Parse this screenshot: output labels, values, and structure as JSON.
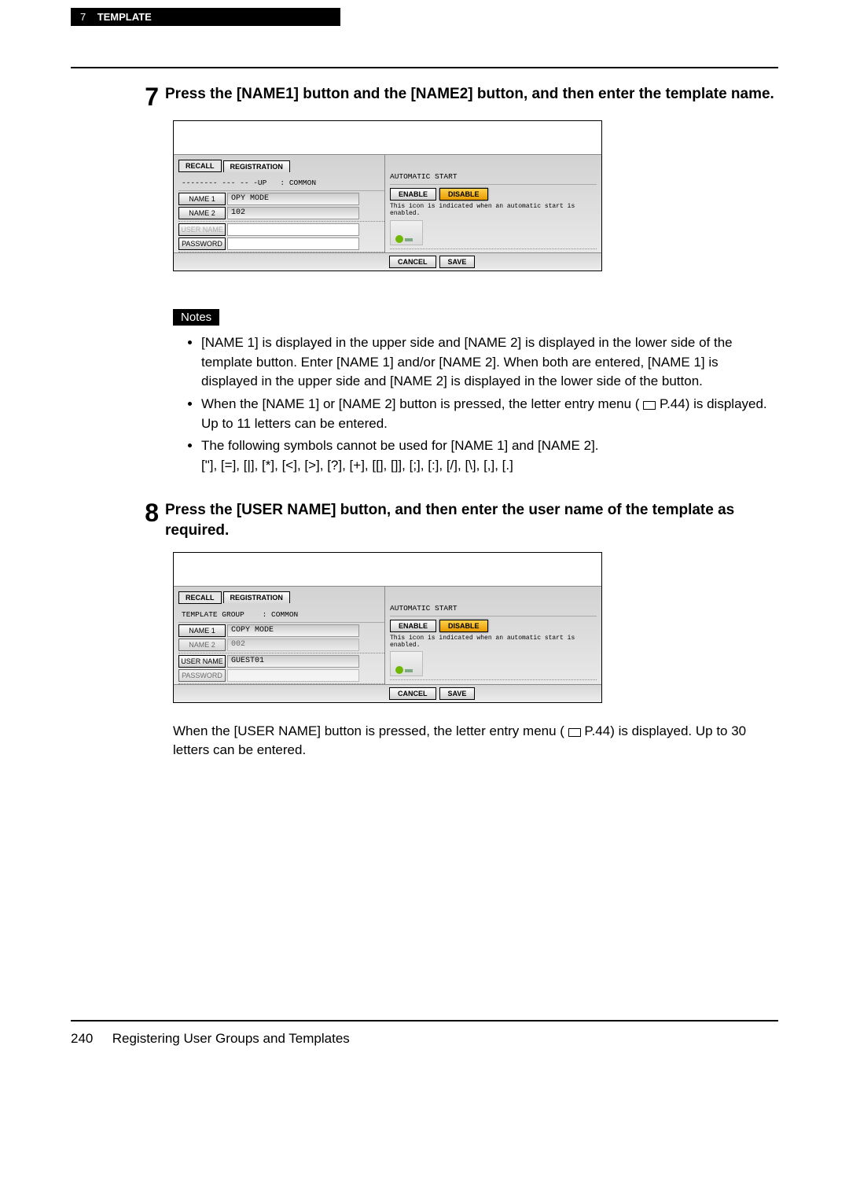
{
  "header": {
    "section_num": "7",
    "section_title": "TEMPLATE"
  },
  "step7": {
    "number": "7",
    "text": "Press the [NAME1] button and the [NAME2] button, and then enter the template name."
  },
  "panel1": {
    "recall": "RECALL",
    "registration": "REGISTRATION",
    "group_line": "-------- --- -- -UP   : COMMON",
    "name1_btn": "NAME 1",
    "name1_val": "OPY MODE",
    "name2_btn": "NAME 2",
    "name2_val": "102",
    "username_btn": "USER NAME",
    "password_btn": "PASSWORD",
    "auto_title": "AUTOMATIC START",
    "enable": "ENABLE",
    "disable": "DISABLE",
    "hint": "This icon is indicated when an automatic start is enabled.",
    "cancel": "CANCEL",
    "save": "SAVE"
  },
  "notes": {
    "title": "Notes",
    "item1": "[NAME 1] is displayed in the upper side and [NAME 2] is displayed in the lower side of the template button. Enter [NAME 1] and/or [NAME 2]. When both are entered, [NAME 1] is displayed in the upper side and [NAME 2] is displayed in the lower side of the button.",
    "item2_a": "When the [NAME 1] or [NAME 2] button is pressed, the letter entry menu (",
    "item2_b": " P.44) is displayed. Up to 11 letters can be entered.",
    "item3_a": "The following symbols cannot be used for [NAME 1] and [NAME 2].",
    "item3_b": "[\"], [=], [|], [*], [<], [>], [?], [+], [[], []], [;], [:], [/], [\\], [,], [.]"
  },
  "step8": {
    "number": "8",
    "text": "Press the [USER NAME] button, and then enter the user name of the template as required."
  },
  "panel2": {
    "recall": "RECALL",
    "registration": "REGISTRATION",
    "group_line": "TEMPLATE GROUP    : COMMON",
    "name1_btn": "NAME 1",
    "name1_val": "COPY MODE",
    "name2_btn": "NAME 2",
    "name2_val": "002",
    "username_btn": "USER NAME",
    "username_val": "GUEST01",
    "password_btn": "PASSWORD",
    "auto_title": "AUTOMATIC START",
    "enable": "ENABLE",
    "disable": "DISABLE",
    "hint": "This icon is indicated when an automatic start is enabled.",
    "cancel": "CANCEL",
    "save": "SAVE"
  },
  "footnote": {
    "part_a": "When the [USER NAME] button is pressed, the letter entry menu (",
    "part_b": " P.44) is displayed. Up to 30 letters can be entered."
  },
  "footer": {
    "page_num": "240",
    "title": "Registering User Groups and Templates"
  }
}
